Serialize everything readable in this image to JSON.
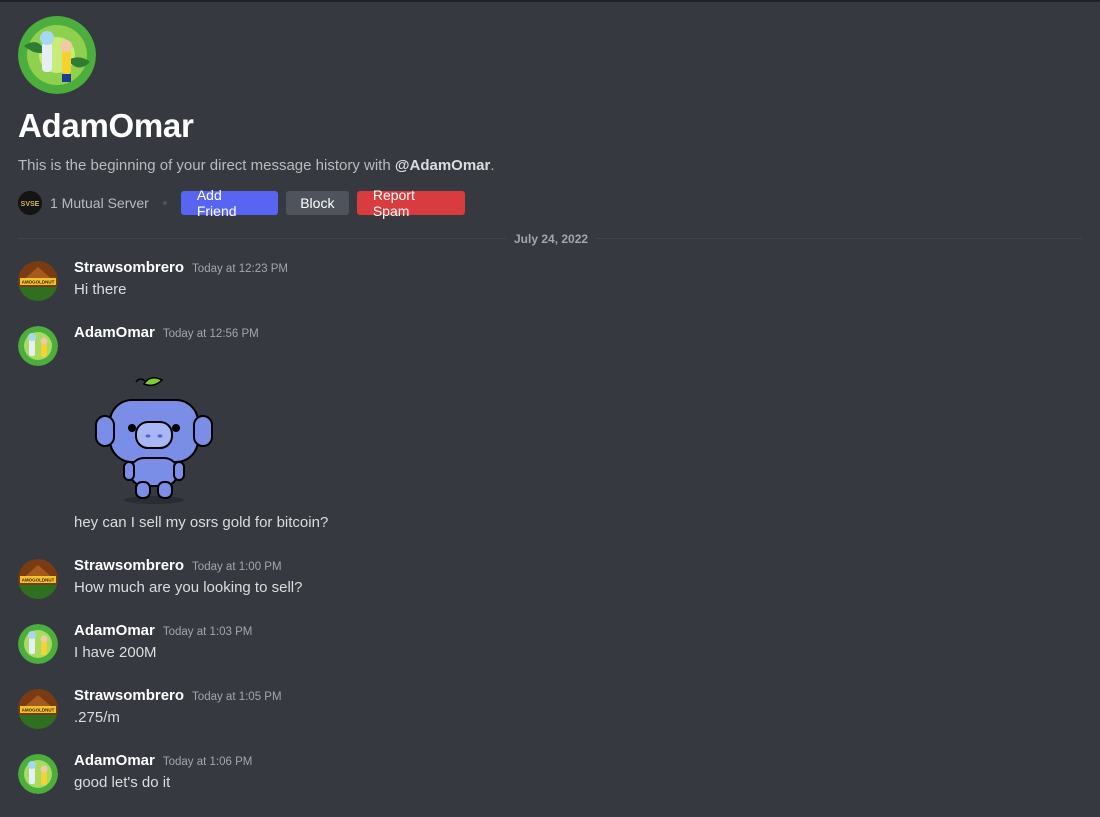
{
  "profile": {
    "title": "AdamOmar",
    "intro_prefix": "This is the beginning of your direct message history with ",
    "intro_handle": "@AdamOmar",
    "intro_suffix": ".",
    "mutual_servers": "1 Mutual Server",
    "server_icon_text": "SVSE",
    "buttons": {
      "add_friend": "Add Friend",
      "block": "Block",
      "report_spam": "Report Spam"
    }
  },
  "date_divider": "July 24, 2022",
  "messages": [
    {
      "author": "Strawsombrero",
      "time": "Today at 12:23 PM",
      "text": "Hi there",
      "avatar": "strawsombrero-avatar"
    },
    {
      "author": "AdamOmar",
      "time": "Today at 12:56 PM",
      "text": "hey can I sell my osrs gold for bitcoin?",
      "avatar": "adamomar-avatar",
      "sticker": "wumpus-sticker"
    },
    {
      "author": "Strawsombrero",
      "time": "Today at 1:00 PM",
      "text": "How much are you looking to sell?",
      "avatar": "strawsombrero-avatar"
    },
    {
      "author": "AdamOmar",
      "time": "Today at 1:03 PM",
      "text": "I have 200M",
      "avatar": "adamomar-avatar"
    },
    {
      "author": "Strawsombrero",
      "time": "Today at 1:05 PM",
      "text": ".275/m",
      "avatar": "strawsombrero-avatar"
    },
    {
      "author": "AdamOmar",
      "time": "Today at 1:06 PM",
      "text": "good let's do it",
      "avatar": "adamomar-avatar"
    }
  ],
  "avatar_text": {
    "strawsombrero": "AMOGOLDNUT"
  },
  "colors": {
    "background": "#36393f",
    "add_friend": "#5865f2",
    "block": "#4f545c",
    "report_spam": "#d83c3e"
  }
}
